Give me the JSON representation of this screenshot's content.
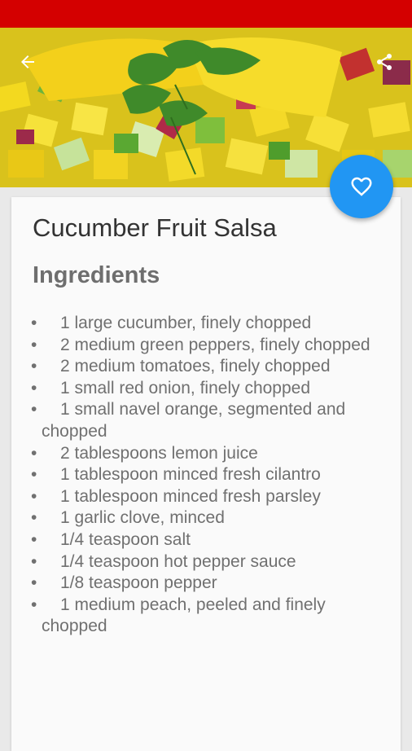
{
  "colors": {
    "status_bar": "#d40000",
    "fab": "#2196f3",
    "card_bg": "#fafafa",
    "title_text": "#333333",
    "heading_text": "#6e6e6e",
    "body_text": "#707070"
  },
  "toolbar": {
    "back_icon": "arrow-left-icon",
    "share_icon": "share-icon"
  },
  "hero": {
    "description_icon": "food-photo"
  },
  "fab": {
    "icon": "heart-outline-icon"
  },
  "recipe": {
    "title": "Cucumber Fruit Salsa",
    "ingredients_heading": "Ingredients",
    "bullet": "•",
    "ingredients": [
      "1 large cucumber, finely chopped",
      "2 medium green peppers, finely chopped",
      "2 medium tomatoes, finely chopped",
      "1 small red onion, finely chopped",
      "1 small navel orange, segmented and chopped",
      "2 tablespoons lemon juice",
      "1 tablespoon minced fresh cilantro",
      "1 tablespoon minced fresh parsley",
      "1 garlic clove, minced",
      "1/4 teaspoon salt",
      "1/4 teaspoon hot pepper sauce",
      "1/8 teaspoon pepper",
      "1 medium peach, peeled and finely chopped"
    ]
  }
}
